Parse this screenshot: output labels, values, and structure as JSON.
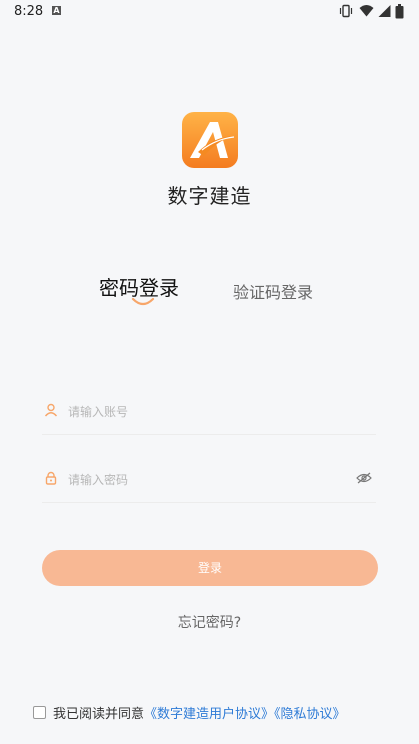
{
  "status_bar": {
    "time": "8:28",
    "notification_glyph": "A"
  },
  "app": {
    "name": "数字建造"
  },
  "tabs": {
    "password_login": "密码登录",
    "code_login": "验证码登录"
  },
  "form": {
    "account_placeholder": "请输入账号",
    "password_placeholder": "请输入密码",
    "login_label": "登录",
    "forgot_label": "忘记密码?"
  },
  "agreement": {
    "prefix": "我已阅读并同意",
    "user_agreement": "《数字建造用户协议》",
    "privacy_policy": "《隐私协议》"
  },
  "colors": {
    "accent": "#f7a66a",
    "button_bg": "#f8b894",
    "link": "#2e7bd6"
  },
  "icons": [
    "user-icon",
    "lock-icon",
    "eye-off-icon",
    "vibrate-icon",
    "wifi-icon",
    "signal-icon",
    "battery-icon"
  ]
}
